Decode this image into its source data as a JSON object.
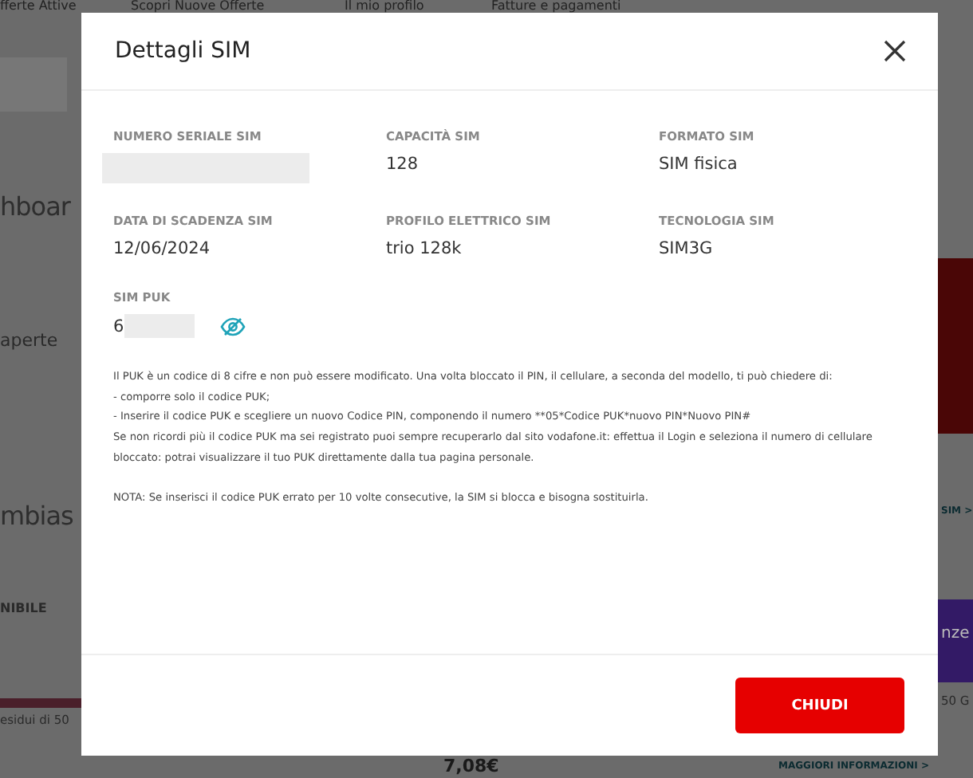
{
  "background_page": {
    "nav": [
      "fferte Attive",
      "Scopri Nuove Offerte",
      "Il mio profilo",
      "Fatture e pagamenti"
    ],
    "left": [
      "hboar",
      "aperte",
      "mbias",
      "NIBILE",
      "esidui di 50"
    ],
    "right": [
      "SIM >",
      "nze",
      "50 G",
      "MAGGIORI INFORMAZIONI >"
    ],
    "price": "7,08€"
  },
  "dialog": {
    "title": "Dettagli SIM",
    "fields": [
      {
        "label": "NUMERO SERIALE SIM",
        "redacted": true
      },
      {
        "label": "CAPACITÀ SIM",
        "value": "128",
        "redacted": false
      },
      {
        "label": "FORMATO SIM",
        "value": "SIM fisica",
        "redacted": false
      },
      {
        "label": "DATA DI SCADENZA SIM",
        "value": "12/06/2024",
        "redacted": false
      },
      {
        "label": "PROFILO ELETTRICO SIM",
        "value": "trio 128k",
        "redacted": false
      },
      {
        "label": "TECNOLOGIA SIM",
        "value": "SIM3G",
        "redacted": false
      }
    ],
    "puk": {
      "label": "SIM PUK",
      "value": "6",
      "hidden": true
    },
    "info": [
      "Il PUK è un codice di 8 cifre e non può essere modificato. Una volta bloccato il PIN, il cellulare, a seconda del modello, ti può chiedere di:",
      "- comporre solo il codice PUK;",
      "- Inserire il codice PUK e scegliere un nuovo Codice PIN, componendo il numero **05*Codice PUK*nuovo PIN*Nuovo PIN#",
      "Se non ricordi più il codice PUK ma sei registrato puoi sempre recuperarlo dal sito vodafone.it: effettua il Login e seleziona il numero di cellulare bloccato: potrai visualizzare il tuo PUK direttamente dalla tua pagina personale."
    ],
    "note": "NOTA: Se inserisci il codice PUK errato per 10 volte consecutive, la SIM si blocca e bisogna sostituirla.",
    "button": "CHIUDI"
  }
}
